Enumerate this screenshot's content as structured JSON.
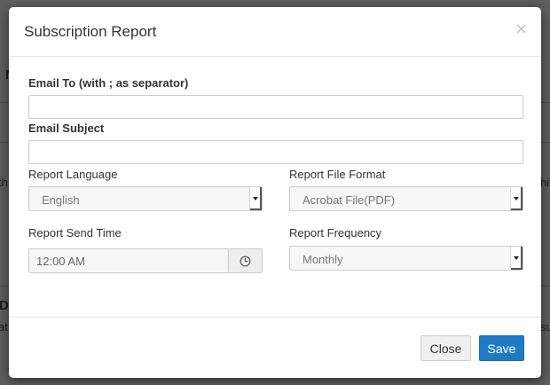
{
  "background": {
    "fragments": [
      "N",
      "th",
      "hi",
      "D",
      "at",
      "su"
    ]
  },
  "dialog": {
    "title": "Subscription Report",
    "close_glyph": "×"
  },
  "form": {
    "email_to": {
      "label": "Email To (with ; as separator)",
      "value": ""
    },
    "email_subject": {
      "label": "Email Subject",
      "value": ""
    },
    "report_language": {
      "label": "Report Language",
      "value": "English"
    },
    "report_file_format": {
      "label": "Report File Format",
      "value": "Acrobat File(PDF)"
    },
    "report_send_time": {
      "label": "Report Send Time",
      "value": "12:00 AM",
      "icon": "clock-icon"
    },
    "report_frequency": {
      "label": "Report Frequency",
      "value": "Monthly"
    }
  },
  "footer": {
    "close_label": "Close",
    "save_label": "Save"
  },
  "colors": {
    "overlay": "#5e5e5e",
    "primary": "#1f7ac6",
    "button_default": "#f0f0f0"
  }
}
